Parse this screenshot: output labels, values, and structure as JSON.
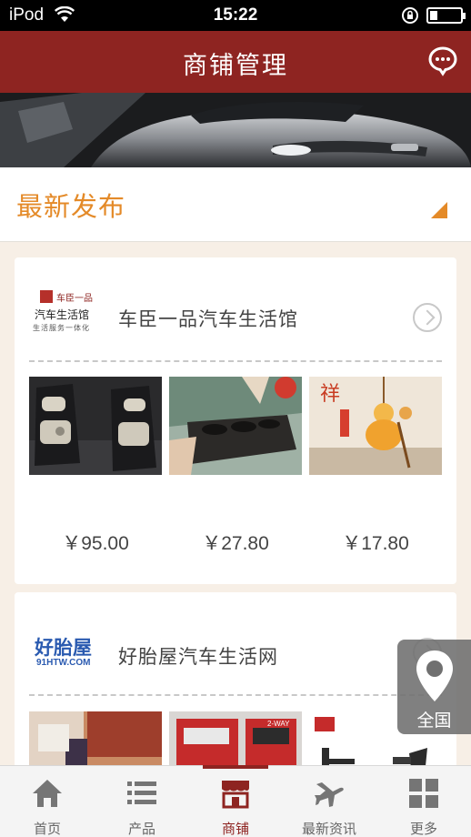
{
  "status_bar": {
    "carrier": "iPod",
    "time": "15:22",
    "wifi_icon": "wifi-icon",
    "lock_icon": "rotation-lock-icon",
    "battery_level": 0.2
  },
  "header": {
    "title": "商铺管理",
    "chat_icon": "chat-bubble-icon",
    "bg_color": "#8e2421"
  },
  "section": {
    "label": "最新发布",
    "accent_color": "#e48a28"
  },
  "stores": [
    {
      "name": "车臣一品汽车生活馆",
      "logo": {
        "brand": "车臣一品",
        "title": "汽车生活馆",
        "tagline": "生活服务一体化"
      },
      "products": [
        {
          "price": "￥95.00",
          "image": "car-seat-cushions-photo"
        },
        {
          "price": "￥27.80",
          "image": "car-cup-holder-photo"
        },
        {
          "price": "￥17.80",
          "image": "gourd-pendant-photo",
          "badge": "祥"
        }
      ]
    },
    {
      "name": "好胎屋汽车生活网",
      "logo": {
        "brand": "好胎屋",
        "domain": "91HTW.COM"
      },
      "products": [
        {
          "image": "tire-products-photo"
        },
        {
          "image": "tech-repair-kit-photo",
          "badge": "2-WAY"
        },
        {
          "image": "tire-tools-photo"
        }
      ]
    }
  ],
  "location": {
    "label": "全国",
    "icon": "map-pin-icon"
  },
  "tabs": [
    {
      "label": "首页",
      "icon": "home-icon",
      "active": false
    },
    {
      "label": "产品",
      "icon": "list-icon",
      "active": false
    },
    {
      "label": "商铺",
      "icon": "store-icon",
      "active": true
    },
    {
      "label": "最新资讯",
      "icon": "news-plane-icon",
      "active": false
    },
    {
      "label": "更多",
      "icon": "grid-icon",
      "active": false
    }
  ]
}
